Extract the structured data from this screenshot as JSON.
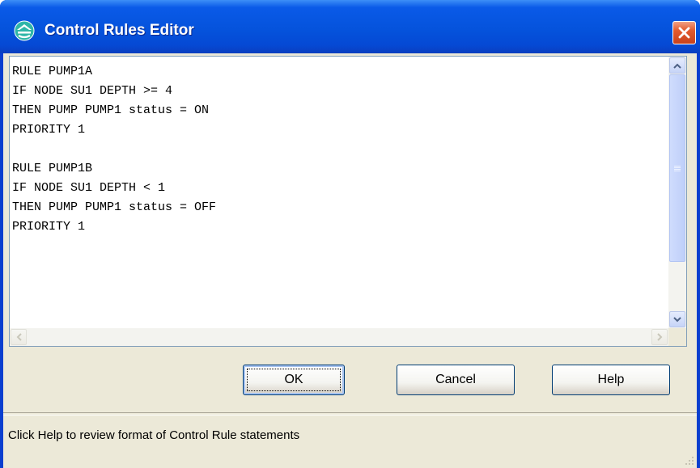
{
  "window": {
    "title": "Control Rules Editor",
    "icon": "app-icon",
    "close_icon": "close-icon"
  },
  "editor": {
    "lines": [
      "RULE PUMP1A",
      "IF NODE SU1 DEPTH >= 4",
      "THEN PUMP PUMP1 status = ON",
      "PRIORITY 1",
      "",
      "RULE PUMP1B",
      "IF NODE SU1 DEPTH < 1",
      "THEN PUMP PUMP1 status = OFF",
      "PRIORITY 1"
    ]
  },
  "buttons": {
    "ok": "OK",
    "cancel": "Cancel",
    "help": "Help"
  },
  "status": {
    "text": "Click Help to review format of Control Rule statements"
  },
  "colors": {
    "title_bar": "#0553dc",
    "dialog_face": "#ece9d8",
    "close_button": "#e35a2e"
  }
}
